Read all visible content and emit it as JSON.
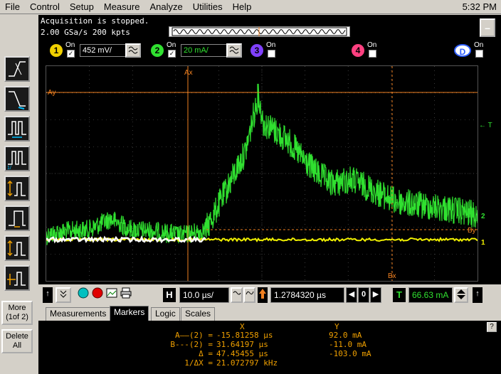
{
  "menu": [
    "File",
    "Control",
    "Setup",
    "Measure",
    "Analyze",
    "Utilities",
    "Help"
  ],
  "clock": "5:32 PM",
  "status": {
    "line1": "Acquisition is stopped.",
    "line2": "2.00 GSa/s   200 kpts",
    "minimize": "–"
  },
  "channels": [
    {
      "num": "1",
      "on": "On",
      "checked": "✓",
      "scale": "452 mV/",
      "color": "#f0d000"
    },
    {
      "num": "2",
      "on": "On",
      "checked": "✓",
      "scale": "20 mA/",
      "color": "#30e030"
    },
    {
      "num": "3",
      "on": "On",
      "checked": "",
      "color": "#8040ff"
    },
    {
      "num": "4",
      "on": "On",
      "checked": "",
      "color": "#ff4080"
    },
    {
      "num": "D",
      "on": "On",
      "checked": "",
      "color": "#3060ff"
    }
  ],
  "graticule": {
    "ax_label": "Ax",
    "ay_label": "Ay",
    "bx_label": "Bx",
    "by_label": "By",
    "trig_label": "← T",
    "ch2_label": "2",
    "ch1_label": "1",
    "trace_color": "#30e030",
    "ch1_color": "#f0f000",
    "marker_color": "#f08020",
    "grid_color": "#606060"
  },
  "sidebar": {
    "more_label": "More\n(1of 2)",
    "delete_label": "Delete\nAll"
  },
  "toolbar": {
    "h_label": "H",
    "timebase": "10.0 µs/",
    "delay": "1.2784320 µs",
    "zero": "0",
    "t_label": "T",
    "trig_level": "66.63 mA"
  },
  "tabs": [
    "Measurements",
    "Markers",
    "Logic",
    "Scales"
  ],
  "markers": {
    "header_x": "X",
    "header_y": "Y",
    "rows": [
      {
        "label": "A——(2) =",
        "x": "-15.81258 µs",
        "y": "92.0 mA"
      },
      {
        "label": "B---(2) =",
        "x": "31.64197 µs",
        "y": "-11.0 mA"
      },
      {
        "label": "Δ =",
        "x": "47.45455 µs",
        "y": "-103.0 mA"
      },
      {
        "label": "1/ΔX =",
        "x": "21.072797 kHz",
        "y": ""
      }
    ],
    "help": "?"
  }
}
